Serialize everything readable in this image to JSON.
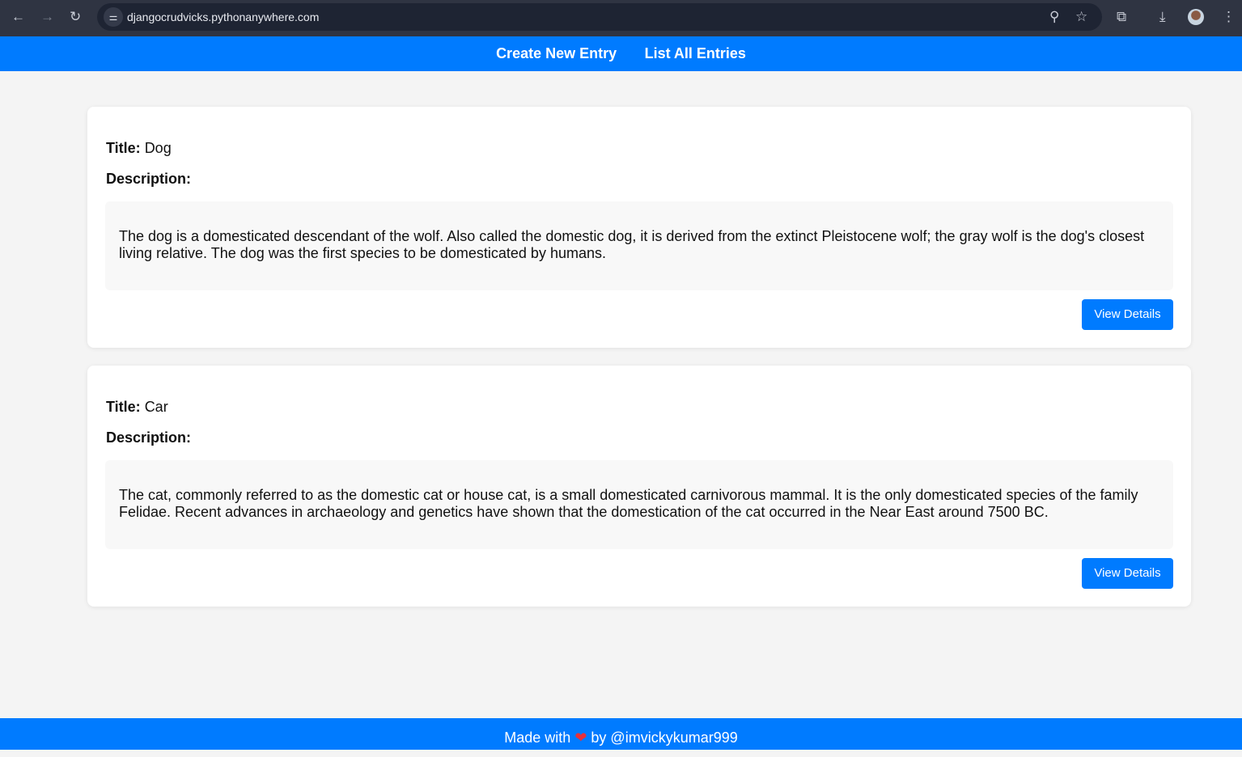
{
  "browser": {
    "url": "djangocrudvicks.pythonanywhere.com"
  },
  "nav": {
    "create": "Create New Entry",
    "list": "List All Entries"
  },
  "labels": {
    "title": "Title:",
    "description": "Description:",
    "view": "View Details"
  },
  "entries": [
    {
      "title": "Dog",
      "description": "The dog is a domesticated descendant of the wolf. Also called the domestic dog, it is derived from the extinct Pleistocene wolf; the gray wolf is the dog's closest living relative. The dog was the first species to be domesticated by humans."
    },
    {
      "title": "Car",
      "description": "The cat, commonly referred to as the domestic cat or house cat, is a small domesticated carnivorous mammal. It is the only domesticated species of the family Felidae. Recent advances in archaeology and genetics have shown that the domestication of the cat occurred in the Near East around 7500 BC."
    }
  ],
  "footer": {
    "made": "Made with",
    "heart": "❤",
    "by": "by @imvickykumar999"
  },
  "colors": {
    "primary": "#007bff",
    "background": "#f4f4f4"
  }
}
